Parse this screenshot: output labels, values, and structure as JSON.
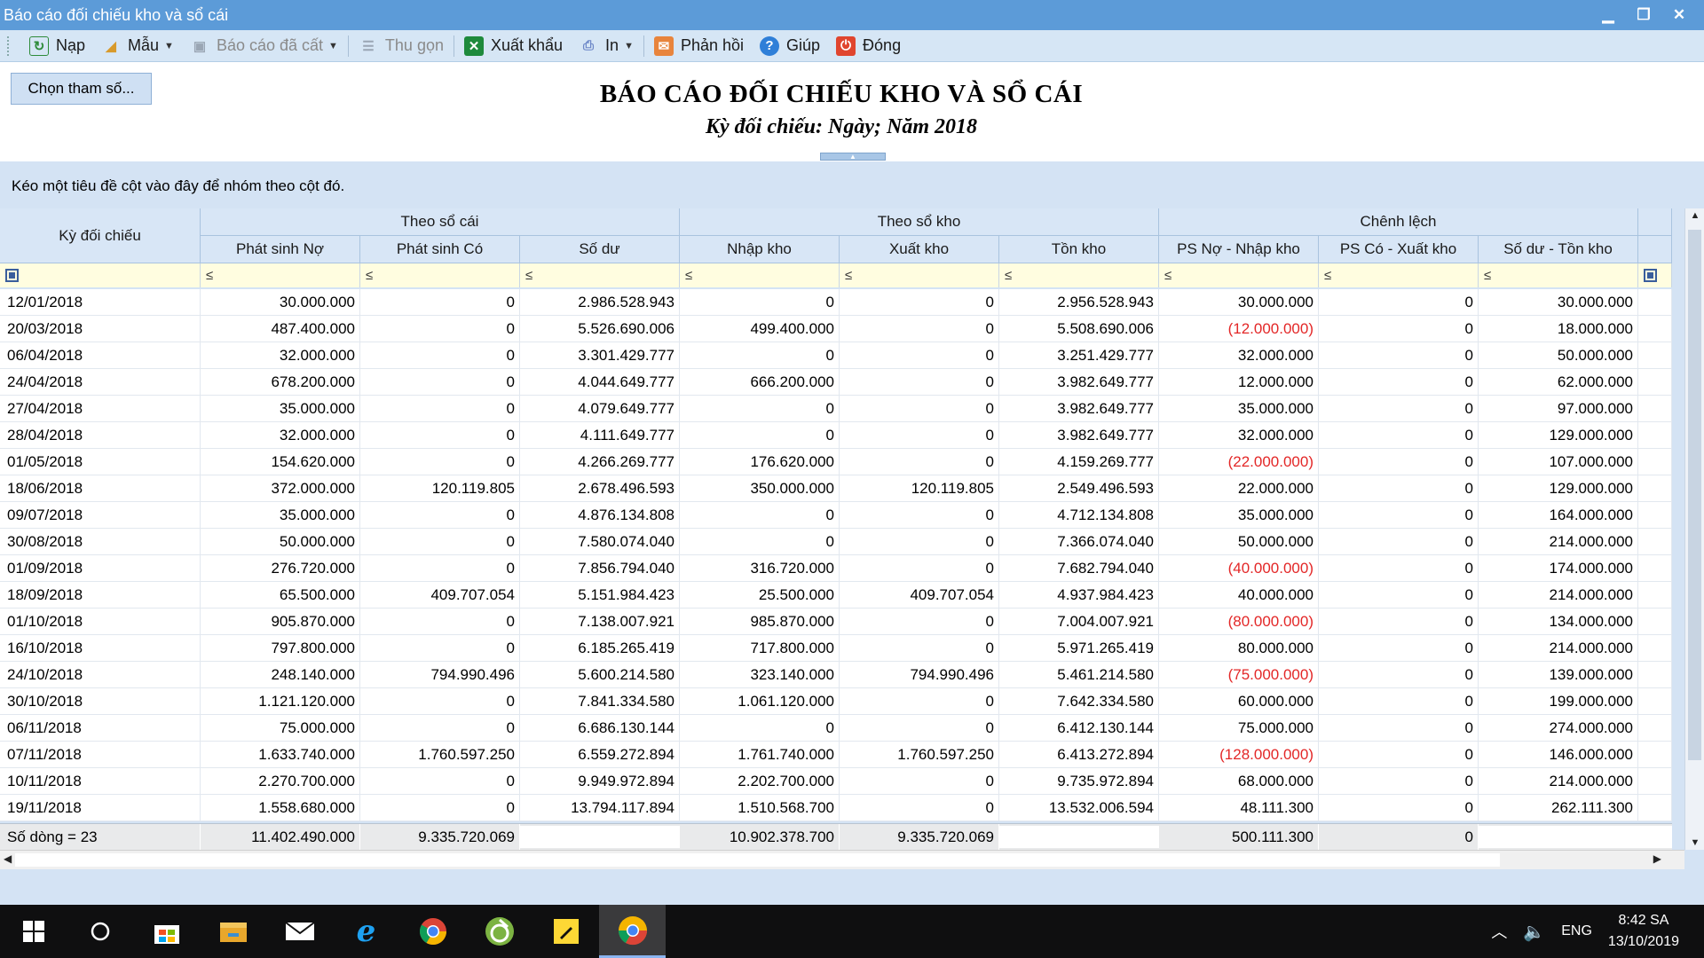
{
  "window": {
    "title": "Báo cáo đối chiếu kho và sổ cái",
    "controls": [
      "▁",
      "❐",
      "✕"
    ]
  },
  "toolbar": {
    "items": [
      {
        "label": "Nạp",
        "icon": "refresh-icon",
        "color": "#2e8b3a"
      },
      {
        "label": "Mẫu",
        "icon": "template-icon",
        "color": "#d89a2b",
        "dropdown": true
      },
      {
        "label": "Báo cáo đã cất",
        "icon": "save-report-icon",
        "color": "#9aa6b4",
        "dropdown": true,
        "disabled": true
      },
      {
        "label": "Thu gọn",
        "icon": "collapse-icon",
        "color": "#9aa6b4",
        "disabled": true
      },
      {
        "label": "Xuất khẩu",
        "icon": "excel-export-icon",
        "color": "#1e8a3c"
      },
      {
        "label": "In",
        "icon": "print-icon",
        "color": "#6b86c7",
        "dropdown": true
      },
      {
        "label": "Phản hồi",
        "icon": "feedback-mail-icon",
        "color": "#e8843c"
      },
      {
        "label": "Giúp",
        "icon": "help-icon",
        "color": "#2f7fd8"
      },
      {
        "label": "Đóng",
        "icon": "close-power-icon",
        "color": "#e0452e"
      }
    ]
  },
  "report": {
    "param_button": "Chọn tham số...",
    "title": "BÁO CÁO ĐỐI CHIẾU KHO VÀ SỔ CÁI",
    "subtitle": "Kỳ đối chiếu: Ngày; Năm 2018"
  },
  "grid": {
    "group_hint": "Kéo một tiêu đề cột vào đây để nhóm theo cột đó.",
    "first_column": "Kỳ đối chiếu",
    "groups": [
      {
        "label": "Theo sổ cái",
        "columns": [
          "Phát sinh Nợ",
          "Phát sinh Có",
          "Số dư"
        ]
      },
      {
        "label": "Theo sổ kho",
        "columns": [
          "Nhập kho",
          "Xuất kho",
          "Tồn kho"
        ]
      },
      {
        "label": "Chênh lệch",
        "columns": [
          "PS Nợ - Nhập kho",
          "PS Có - Xuất kho",
          "Số dư - Tồn kho"
        ]
      }
    ],
    "filter_symbol": "≤",
    "rows": [
      [
        "12/01/2018",
        "30.000.000",
        "0",
        "2.986.528.943",
        "0",
        "0",
        "2.956.528.943",
        "30.000.000",
        "0",
        "30.000.000"
      ],
      [
        "20/03/2018",
        "487.400.000",
        "0",
        "5.526.690.006",
        "499.400.000",
        "0",
        "5.508.690.006",
        "(12.000.000)",
        "0",
        "18.000.000"
      ],
      [
        "06/04/2018",
        "32.000.000",
        "0",
        "3.301.429.777",
        "0",
        "0",
        "3.251.429.777",
        "32.000.000",
        "0",
        "50.000.000"
      ],
      [
        "24/04/2018",
        "678.200.000",
        "0",
        "4.044.649.777",
        "666.200.000",
        "0",
        "3.982.649.777",
        "12.000.000",
        "0",
        "62.000.000"
      ],
      [
        "27/04/2018",
        "35.000.000",
        "0",
        "4.079.649.777",
        "0",
        "0",
        "3.982.649.777",
        "35.000.000",
        "0",
        "97.000.000"
      ],
      [
        "28/04/2018",
        "32.000.000",
        "0",
        "4.111.649.777",
        "0",
        "0",
        "3.982.649.777",
        "32.000.000",
        "0",
        "129.000.000"
      ],
      [
        "01/05/2018",
        "154.620.000",
        "0",
        "4.266.269.777",
        "176.620.000",
        "0",
        "4.159.269.777",
        "(22.000.000)",
        "0",
        "107.000.000"
      ],
      [
        "18/06/2018",
        "372.000.000",
        "120.119.805",
        "2.678.496.593",
        "350.000.000",
        "120.119.805",
        "2.549.496.593",
        "22.000.000",
        "0",
        "129.000.000"
      ],
      [
        "09/07/2018",
        "35.000.000",
        "0",
        "4.876.134.808",
        "0",
        "0",
        "4.712.134.808",
        "35.000.000",
        "0",
        "164.000.000"
      ],
      [
        "30/08/2018",
        "50.000.000",
        "0",
        "7.580.074.040",
        "0",
        "0",
        "7.366.074.040",
        "50.000.000",
        "0",
        "214.000.000"
      ],
      [
        "01/09/2018",
        "276.720.000",
        "0",
        "7.856.794.040",
        "316.720.000",
        "0",
        "7.682.794.040",
        "(40.000.000)",
        "0",
        "174.000.000"
      ],
      [
        "18/09/2018",
        "65.500.000",
        "409.707.054",
        "5.151.984.423",
        "25.500.000",
        "409.707.054",
        "4.937.984.423",
        "40.000.000",
        "0",
        "214.000.000"
      ],
      [
        "01/10/2018",
        "905.870.000",
        "0",
        "7.138.007.921",
        "985.870.000",
        "0",
        "7.004.007.921",
        "(80.000.000)",
        "0",
        "134.000.000"
      ],
      [
        "16/10/2018",
        "797.800.000",
        "0",
        "6.185.265.419",
        "717.800.000",
        "0",
        "5.971.265.419",
        "80.000.000",
        "0",
        "214.000.000"
      ],
      [
        "24/10/2018",
        "248.140.000",
        "794.990.496",
        "5.600.214.580",
        "323.140.000",
        "794.990.496",
        "5.461.214.580",
        "(75.000.000)",
        "0",
        "139.000.000"
      ],
      [
        "30/10/2018",
        "1.121.120.000",
        "0",
        "7.841.334.580",
        "1.061.120.000",
        "0",
        "7.642.334.580",
        "60.000.000",
        "0",
        "199.000.000"
      ],
      [
        "06/11/2018",
        "75.000.000",
        "0",
        "6.686.130.144",
        "0",
        "0",
        "6.412.130.144",
        "75.000.000",
        "0",
        "274.000.000"
      ],
      [
        "07/11/2018",
        "1.633.740.000",
        "1.760.597.250",
        "6.559.272.894",
        "1.761.740.000",
        "1.760.597.250",
        "6.413.272.894",
        "(128.000.000)",
        "0",
        "146.000.000"
      ],
      [
        "10/11/2018",
        "2.270.700.000",
        "0",
        "9.949.972.894",
        "2.202.700.000",
        "0",
        "9.735.972.894",
        "68.000.000",
        "0",
        "214.000.000"
      ],
      [
        "19/11/2018",
        "1.558.680.000",
        "0",
        "13.794.117.894",
        "1.510.568.700",
        "0",
        "13.532.006.594",
        "48.111.300",
        "0",
        "262.111.300"
      ]
    ],
    "footer": [
      "Số dòng = 23",
      "11.402.490.000",
      "9.335.720.069",
      "",
      "10.902.378.700",
      "9.335.720.069",
      "",
      "500.111.300",
      "0",
      ""
    ]
  },
  "taskbar": {
    "apps": [
      "windows-start-icon",
      "cortana-search-icon",
      "store-icon",
      "file-explorer-icon",
      "mail-icon",
      "internet-explorer-icon",
      "chrome-icon",
      "misa-icon",
      "sticky-notes-icon",
      "chrome-canary-icon"
    ],
    "lang": "ENG",
    "time": "8:42 SA",
    "date": "13/10/2019"
  },
  "colors": {
    "accent": "#5c9bd8",
    "negative": "#e32727",
    "panel": "#d4e3f4"
  }
}
